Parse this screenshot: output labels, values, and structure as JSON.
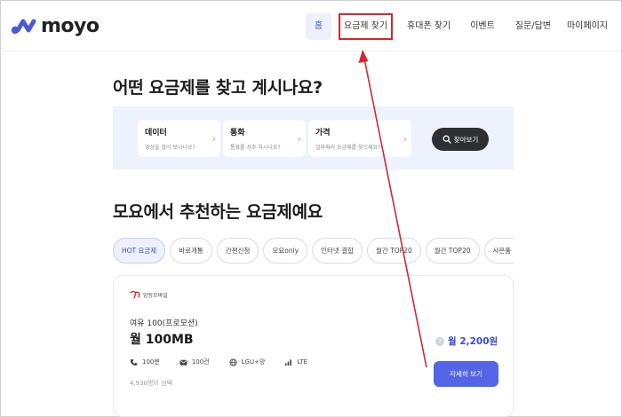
{
  "header": {
    "logo_text": "moyo",
    "nav": [
      "홈",
      "요금제 찾기",
      "휴대폰 찾기",
      "이벤트",
      "질문/답변",
      "마이페이지"
    ]
  },
  "section1": {
    "title": "어떤 요금제를 찾고 계시나요?",
    "filters": [
      {
        "title": "데이터",
        "subtitle": "영상을 많이 보시나요?"
      },
      {
        "title": "통화",
        "subtitle": "통화를 자주 하시나요?"
      },
      {
        "title": "가격",
        "subtitle": "얼마짜리 요금제를 찾으세요?"
      }
    ],
    "search_button": "찾아보기"
  },
  "section2": {
    "title": "모요에서 추천하는 요금제예요",
    "tabs": [
      "HOT 요금제",
      "바로개통",
      "간편신청",
      "모요only",
      "인터넷 결합",
      "월간 TOP20",
      "월간 TOP20",
      "사은품 가득"
    ]
  },
  "plan": {
    "carrier": "앙등모바일",
    "name": "여유 100(프로모션)",
    "data": "월 100MB",
    "specs": {
      "voice": "100분",
      "sms": "100건",
      "network": "LGU+망",
      "tech": "LTE"
    },
    "selected": "4,930명이 선택",
    "price": "월 2,200원",
    "detail_button": "자세히 보기"
  },
  "colors": {
    "accent": "#5465e8",
    "highlight": "#d2282f",
    "filter_bg": "#eef2fd"
  }
}
